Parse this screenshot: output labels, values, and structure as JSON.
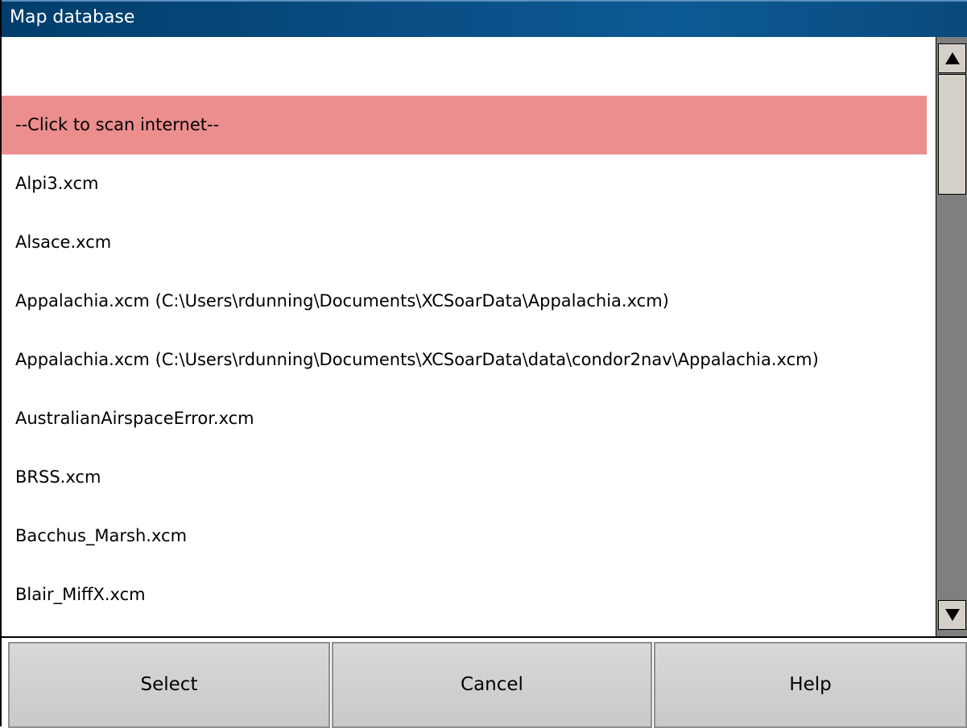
{
  "window": {
    "title": "Map database"
  },
  "list": {
    "items": [
      {
        "label": "",
        "selected": false
      },
      {
        "label": "--Click to scan internet--",
        "selected": true
      },
      {
        "label": "Alpi3.xcm",
        "selected": false
      },
      {
        "label": "Alsace.xcm",
        "selected": false
      },
      {
        "label": "Appalachia.xcm (C:\\Users\\rdunning\\Documents\\XCSoarData\\Appalachia.xcm)",
        "selected": false
      },
      {
        "label": "Appalachia.xcm (C:\\Users\\rdunning\\Documents\\XCSoarData\\data\\condor2nav\\Appalachia.xcm)",
        "selected": false
      },
      {
        "label": "AustralianAirspaceError.xcm",
        "selected": false
      },
      {
        "label": "BRSS.xcm",
        "selected": false
      },
      {
        "label": "Bacchus_Marsh.xcm",
        "selected": false
      },
      {
        "label": "Blair_MiffX.xcm",
        "selected": false
      }
    ],
    "selected_color": "#ec8e8e"
  },
  "scrollbar": {
    "up_icon": "arrow-up-icon",
    "down_icon": "arrow-down-icon"
  },
  "buttons": {
    "select_label": "Select",
    "cancel_label": "Cancel",
    "help_label": "Help"
  },
  "colors": {
    "titlebar": "#0a4f86",
    "scrollbar_track": "#7f7f7f",
    "button_face": "#d0d0d0"
  }
}
